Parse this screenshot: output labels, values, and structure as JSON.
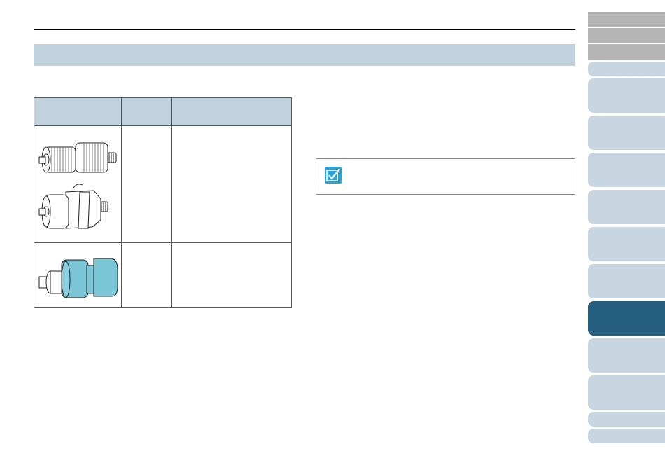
{
  "header": {
    "title": ""
  },
  "section": {
    "title": ""
  },
  "parts_table": {
    "columns": [
      "",
      "",
      ""
    ],
    "rows": [
      {
        "name": "",
        "part_no": "",
        "cycle": "",
        "image": "pick-roller-and-brake-roller"
      },
      {
        "name": "",
        "part_no": "",
        "cycle": "",
        "image": "blue-roller"
      }
    ]
  },
  "hint": {
    "icon": "check-icon",
    "text": ""
  },
  "side_nav": {
    "tabs": [
      {
        "label": "",
        "style": "grey"
      },
      {
        "label": "",
        "style": "grey"
      },
      {
        "label": "",
        "style": "grey"
      },
      {
        "label": "",
        "style": "light"
      },
      {
        "label": "",
        "style": "light"
      },
      {
        "label": "",
        "style": "light"
      },
      {
        "label": "",
        "style": "light"
      },
      {
        "label": "",
        "style": "light"
      },
      {
        "label": "",
        "style": "light"
      },
      {
        "label": "",
        "style": "light"
      },
      {
        "label": "",
        "style": "active"
      },
      {
        "label": "",
        "style": "light"
      },
      {
        "label": "",
        "style": "light"
      },
      {
        "label": "",
        "style": "light"
      },
      {
        "label": "",
        "style": "light"
      }
    ],
    "colors": {
      "grey": "#b5b5b5",
      "light": "#c7d6e1",
      "active": "#265e80"
    }
  },
  "colors": {
    "section_bar": "#c0d2de",
    "hint_check": "#29a3d6",
    "roller_blue": "#7ac5d6"
  }
}
